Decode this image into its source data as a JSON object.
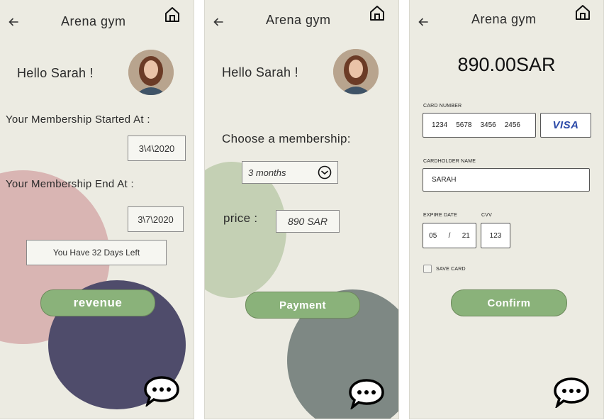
{
  "app": {
    "title": "Arena gym"
  },
  "screen1": {
    "greeting": "Hello Sarah !",
    "start_label": "Your Membership Started At :",
    "start_date": "3\\4\\2020",
    "end_label": "Your Membership End At :",
    "end_date": "3\\7\\2020",
    "days_left": "You Have 32 Days Left",
    "revenue_button": "revenue"
  },
  "screen2": {
    "greeting": "Hello Sarah !",
    "choose_label": "Choose a membership:",
    "membership_selected": "3 months",
    "price_label": "price :",
    "price_value": "890 SAR",
    "payment_button": "Payment"
  },
  "screen3": {
    "amount": "890.00SAR",
    "card_number_label": "CARD NUMBER",
    "card_number_groups": [
      "1234",
      "5678",
      "3456",
      "2456"
    ],
    "card_brand": "VISA",
    "cardholder_label": "CARDHOLDER NAME",
    "cardholder_value": "SARAH",
    "expire_label": "EXPIRE DATE",
    "expire_month": "05",
    "expire_sep": "/",
    "expire_year": "21",
    "cvv_label": "CVV",
    "cvv_value": "123",
    "save_card_label": "SAVE CARD",
    "confirm_button": "Confirm"
  },
  "colors": {
    "screen_bg": "#ecebe2",
    "button_green": "#8ab27a",
    "deco_pink": "#d9b5b3",
    "deco_navy": "#4f4c6b",
    "deco_sage": "#c4d0b4",
    "deco_slate": "#7e8884",
    "visa_blue": "#2c4aa8"
  },
  "icons": [
    "back-arrow-icon",
    "home-icon",
    "chat-bubble-icon",
    "chevron-down-circle-icon",
    "checkbox-icon"
  ]
}
